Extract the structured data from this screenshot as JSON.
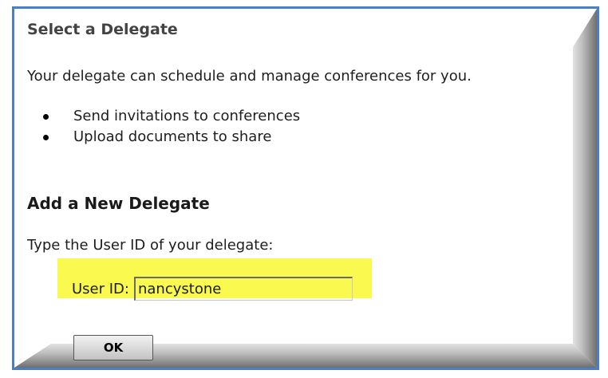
{
  "dialog": {
    "title": "Select a Delegate",
    "intro": "Your delegate can schedule and manage conferences for you.",
    "bullets": [
      "Send invitations to conferences",
      "Upload documents to share"
    ],
    "subtitle": "Add a New Delegate",
    "instruction": "Type the User ID of your delegate:",
    "user_id_label": "User ID:",
    "user_id_value": "nancystone",
    "ok_label": "OK"
  },
  "colors": {
    "border": "#4a7fc8",
    "highlight": "#f9f950",
    "title_text": "#434343",
    "button_face": "#d6d6d6"
  }
}
